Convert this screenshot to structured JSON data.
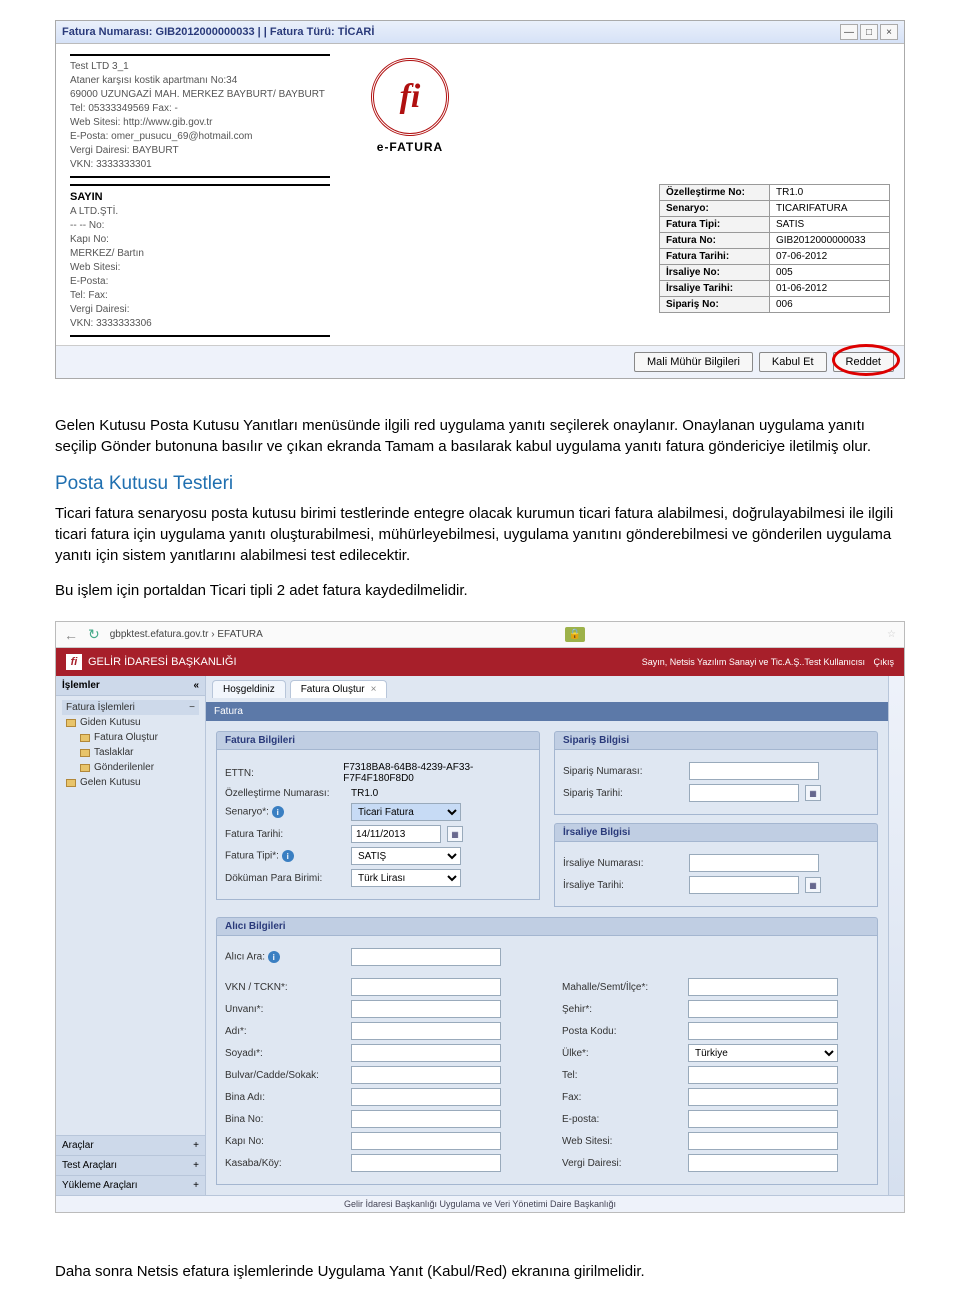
{
  "efatura": {
    "titlebar": "Fatura Numarası: GIB2012000000033 | | Fatura Türü: TİCARİ",
    "sender": {
      "name": "Test LTD 3_1",
      "addr1": "Ataner karşısı kostik apartmanı No:34",
      "addr2": "69000 UZUNGAZİ MAH. MERKEZ BAYBURT/ BAYBURT",
      "tel": "Tel: 05333349569 Fax: -",
      "web": "Web Sitesi: http://www.gib.gov.tr",
      "eposta": "E-Posta: omer_pusucu_69@hotmail.com",
      "vd": "Vergi Dairesi: BAYBURT",
      "vkn": "VKN: 3333333301"
    },
    "logo_label": "e-FATURA",
    "recipient": {
      "sayin": "SAYIN",
      "name": "A LTD.ŞTİ.",
      "no": "-- -- No:",
      "kapi": "Kapı No:",
      "addr": "  MERKEZ/ Bartın",
      "web": "Web Sitesi:",
      "eposta": "E-Posta:",
      "tel": "Tel: Fax:",
      "vd": "Vergi Dairesi:",
      "vkn": "VKN: 3333333306"
    },
    "meta": [
      [
        "Özelleştirme No:",
        "TR1.0"
      ],
      [
        "Senaryo:",
        "TICARIFATURA"
      ],
      [
        "Fatura Tipi:",
        "SATIS"
      ],
      [
        "Fatura No:",
        "GIB2012000000033"
      ],
      [
        "Fatura Tarihi:",
        "07-06-2012"
      ],
      [
        "İrsaliye No:",
        "005"
      ],
      [
        "İrsaliye Tarihi:",
        "01-06-2012"
      ],
      [
        "Sipariş No:",
        "006"
      ]
    ],
    "buttons": {
      "mali": "Mali Mühür Bilgileri",
      "kabul": "Kabul Et",
      "reddet": "Reddet"
    }
  },
  "doc": {
    "p1": "Gelen Kutusu Posta Kutusu Yanıtları menüsünde ilgili red uygulama yanıtı seçilerek onaylanır. Onaylanan uygulama yanıtı seçilip Gönder butonuna basılır ve çıkan ekranda Tamam a basılarak kabul uygulama yanıtı fatura göndericiye iletilmiş olur.",
    "h2": "Posta Kutusu Testleri",
    "p2": "Ticari fatura senaryosu posta kutusu birimi testlerinde entegre olacak kurumun ticari fatura alabilmesi, doğrulayabilmesi ile ilgili ticari fatura için uygulama yanıtı oluşturabilmesi, mühürleyebilmesi, uygulama yanıtını gönderebilmesi ve gönderilen uygulama yanıtı için sistem yanıtlarını alabilmesi test edilecektir.",
    "p3": "Bu işlem için portaldan Ticari tipli 2 adet fatura kaydedilmelidir.",
    "trailing": "Daha sonra Netsis efatura işlemlerinde Uygulama Yanıt (Kabul/Red) ekranına girilmelidir."
  },
  "portal": {
    "url": "gbpktest.efatura.gov.tr › EFATURA",
    "header_title": "GELİR İDARESİ BAŞKANLIĞI",
    "user_text": "Sayın, Netsis Yazılım Sanayi ve Tic.A.Ş..Test Kullanıcısı",
    "logout": "Çıkış",
    "sidebar": {
      "title": "İşlemler",
      "group_title": "Fatura İşlemleri",
      "tree": [
        "Giden Kutusu",
        "Fatura Oluştur",
        "Taslaklar",
        "Gönderilenler",
        "Gelen Kutusu"
      ],
      "bottom": [
        "Araçlar",
        "Test Araçları",
        "Yükleme Araçları"
      ]
    },
    "tabs": {
      "hosgeldiniz": "Hoşgeldiniz",
      "fatura_olustur": "Fatura Oluştur"
    },
    "formbar": "Fatura",
    "fatura_bilgileri": {
      "title": "Fatura Bilgileri",
      "ettn_label": "ETTN:",
      "ettn_value": "F7318BA8-64B8-4239-AF33-F7F4F180F8D0",
      "ozellestirme_label": "Özelleştirme Numarası:",
      "ozellestirme_value": "TR1.0",
      "senaryo_label": "Senaryo*:",
      "senaryo_value": "Ticari Fatura",
      "tarih_label": "Fatura Tarihi:",
      "tarih_value": "14/11/2013",
      "tip_label": "Fatura Tipi*:",
      "tip_value": "SATIŞ",
      "para_label": "Döküman Para Birimi:",
      "para_value": "Türk Lirası"
    },
    "siparis": {
      "title": "Sipariş Bilgisi",
      "no_label": "Sipariş Numarası:",
      "tarih_label": "Sipariş Tarihi:"
    },
    "irsaliye": {
      "title": "İrsaliye Bilgisi",
      "no_label": "İrsaliye Numarası:",
      "tarih_label": "İrsaliye Tarihi:"
    },
    "alici": {
      "title": "Alıcı Bilgileri",
      "ara_label": "Alıcı Ara:",
      "left_labels": [
        "VKN / TCKN*:",
        "Unvanı*:",
        "Adı*:",
        "Soyadı*:",
        "Bulvar/Cadde/Sokak:",
        "Bina Adı:",
        "Bina No:",
        "Kapı No:",
        "Kasaba/Köy:"
      ],
      "right_labels": [
        "Mahalle/Semt/İlçe*:",
        "Şehir*:",
        "Posta Kodu:",
        "Ülke*:",
        "Tel:",
        "Fax:",
        "E-posta:",
        "Web Sitesi:",
        "Vergi Dairesi:"
      ],
      "ulke_value": "Türkiye"
    },
    "footer": "Gelir İdaresi Başkanlığı Uygulama ve Veri Yönetimi Daire Başkanlığı"
  }
}
